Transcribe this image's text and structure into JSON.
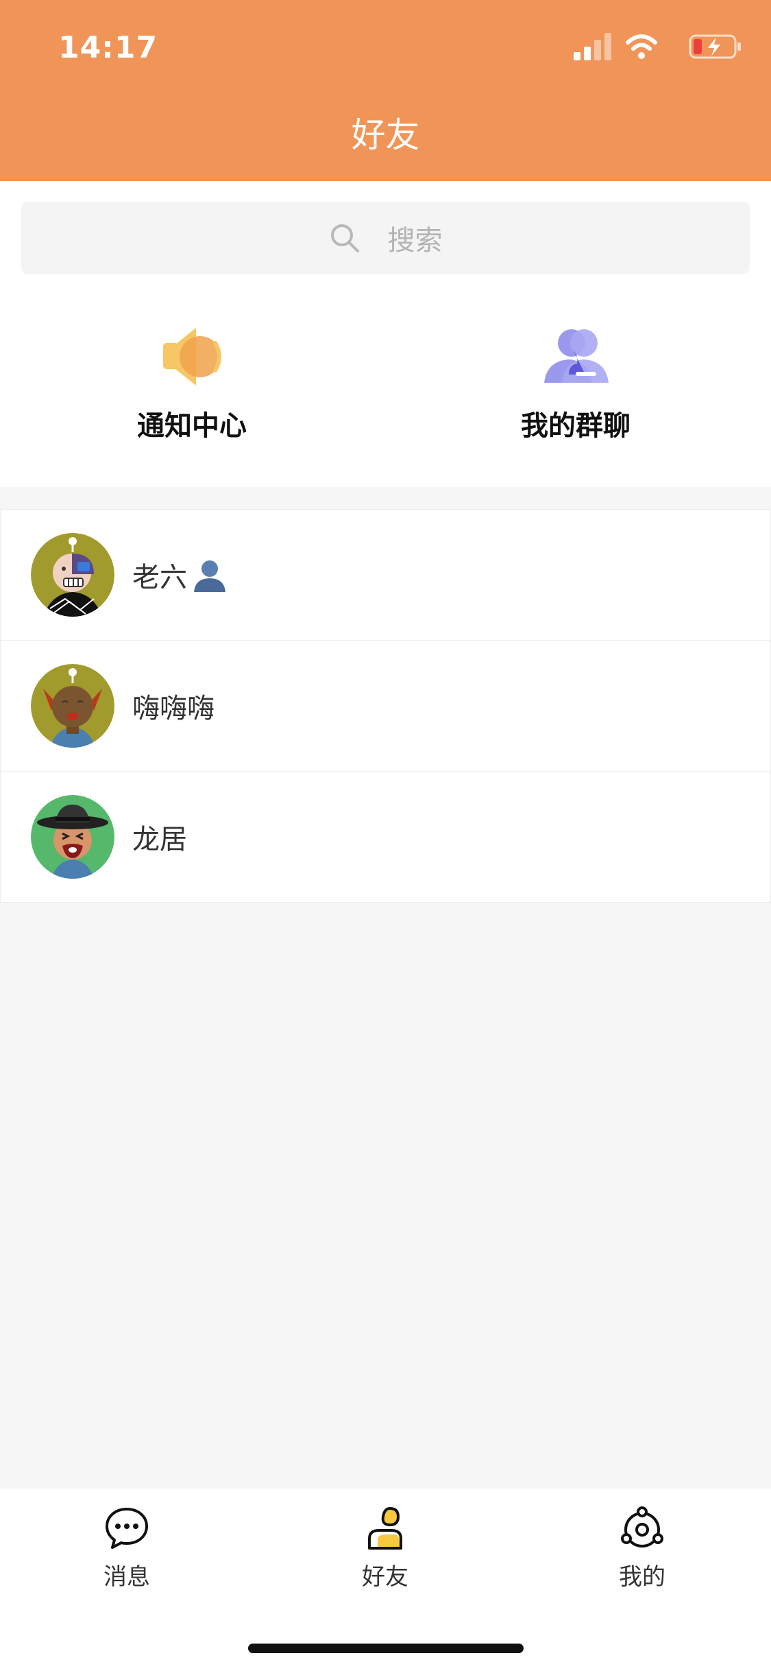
{
  "status_bar": {
    "time": "14:17"
  },
  "header": {
    "title": "好友"
  },
  "search": {
    "placeholder": "搜索"
  },
  "quick_entries": [
    {
      "label": "通知中心",
      "icon": "speaker-icon"
    },
    {
      "label": "我的群聊",
      "icon": "group-icon"
    }
  ],
  "friends": [
    {
      "name": "老六",
      "badge_icon": "person-silhouette-icon"
    },
    {
      "name": "嗨嗨嗨"
    },
    {
      "name": "龙居"
    }
  ],
  "tabbar": {
    "tabs": [
      {
        "label": "消息",
        "icon": "chat-bubble-icon"
      },
      {
        "label": "好友",
        "icon": "friend-icon"
      },
      {
        "label": "我的",
        "icon": "profile-hub-icon"
      }
    ]
  },
  "colors": {
    "header_bg": "#f19457",
    "accent_orange": "#f5a84a",
    "group_purple": "#7b78e6"
  }
}
